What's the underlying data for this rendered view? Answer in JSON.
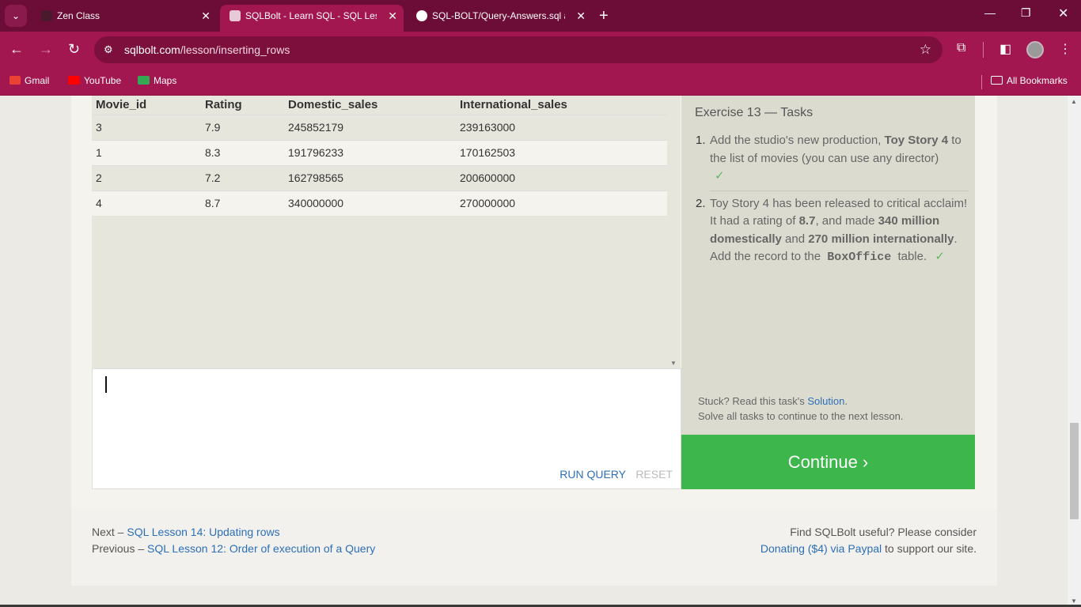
{
  "browser": {
    "tabs": [
      {
        "label": "Zen Class",
        "close": "✕"
      },
      {
        "label": "SQLBolt - Learn SQL - SQL Less",
        "close": "✕"
      },
      {
        "label": "SQL-BOLT/Query-Answers.sql a",
        "close": "✕"
      }
    ],
    "new_tab": "+",
    "url_host": "sqlbolt.com",
    "url_path": "/lesson/inserting_rows",
    "bookmarks": [
      "Gmail",
      "YouTube",
      "Maps"
    ],
    "all_bookmarks": "All Bookmarks",
    "colors": {
      "tabbar": "#6b0d36",
      "toolbar": "#a2174f"
    }
  },
  "results": {
    "columns": [
      "Movie_id",
      "Rating",
      "Domestic_sales",
      "International_sales"
    ],
    "rows": [
      [
        "3",
        "7.9",
        "245852179",
        "239163000"
      ],
      [
        "1",
        "8.3",
        "191796233",
        "170162503"
      ],
      [
        "2",
        "7.2",
        "162798565",
        "200600000"
      ],
      [
        "4",
        "8.7",
        "340000000",
        "270000000"
      ]
    ]
  },
  "editor": {
    "run_label": "RUN QUERY",
    "reset_label": "RESET"
  },
  "tasks": {
    "title": "Exercise 13 — Tasks",
    "item1": {
      "num": "1.",
      "text_a": "Add the studio's new production,",
      "bold_a": "Toy Story 4",
      "text_b": "to the list of movies (you can use any director)",
      "check": "✓"
    },
    "item2": {
      "num": "2.",
      "text_a": "Toy Story 4 has been released to critical acclaim! It had a rating of",
      "bold_a": "8.7",
      "text_b": ", and made",
      "bold_b": "340 million domestically",
      "text_c": "and",
      "bold_c": "270 million internationally",
      "text_d": ". Add the record to the",
      "code": "BoxOffice",
      "text_e": "table.",
      "check": "✓"
    },
    "stuck_prefix": "Stuck? Read this task's",
    "stuck_link": "Solution",
    "stuck_suffix": ".",
    "solve_all": "Solve all tasks to continue to the next lesson."
  },
  "continue_label": "Continue ›",
  "footer": {
    "next_prefix": "Next – ",
    "next_link": "SQL Lesson 14: Updating rows",
    "prev_prefix": "Previous – ",
    "prev_link": "SQL Lesson 12: Order of execution of a Query",
    "donate_line": "Find SQLBolt useful? Please consider",
    "donate_link": "Donating ($4) via Paypal",
    "donate_suffix": " to support our site."
  }
}
